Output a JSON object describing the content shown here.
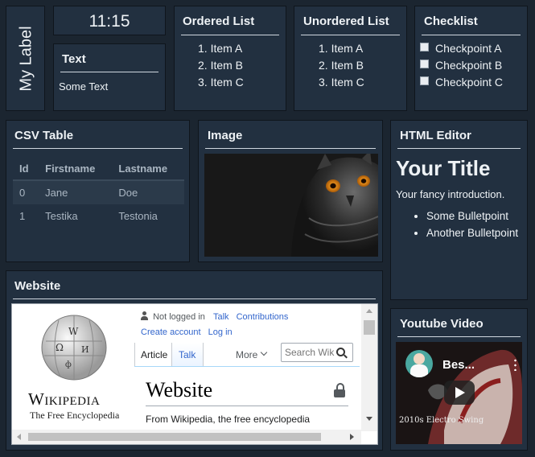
{
  "clock": {
    "time": "11:15"
  },
  "label_widget": {
    "text": "My Label"
  },
  "text_widget": {
    "title": "Text",
    "body": "Some Text"
  },
  "ordered_list": {
    "title": "Ordered List",
    "items": [
      "1. Item A",
      "2. Item B",
      "3. Item C"
    ]
  },
  "unordered_list": {
    "title": "Unordered List",
    "items": [
      "1. Item A",
      "2. Item B",
      "3. Item C"
    ]
  },
  "checklist": {
    "title": "Checklist",
    "items": [
      "Checkpoint A",
      "Checkpoint B",
      "Checkpoint C"
    ]
  },
  "csv_table": {
    "title": "CSV Table",
    "headers": [
      "Id",
      "Firstname",
      "Lastname"
    ],
    "rows": [
      [
        "0",
        "Jane",
        "Doe"
      ],
      [
        "1",
        "Testika",
        "Testonia"
      ]
    ]
  },
  "image_widget": {
    "title": "Image"
  },
  "html_editor": {
    "title": "HTML Editor",
    "heading": "Your Title",
    "intro": "Your fancy introduction.",
    "bullets": [
      "Some Bulletpoint",
      "Another Bulletpoint"
    ]
  },
  "website": {
    "title": "Website",
    "wordmark": "Wikipedia",
    "tagline": "The Free Encyclopedia",
    "not_logged_in": "Not logged in",
    "talk": "Talk",
    "contributions": "Contributions",
    "create_account": "Create account",
    "log_in": "Log in",
    "tab_article": "Article",
    "tab_talk": "Talk",
    "more": "More",
    "search_placeholder": "Search Wiki",
    "page_heading": "Website",
    "from_line": "From Wikipedia, the free encyclopedia"
  },
  "youtube": {
    "title": "Youtube Video",
    "video_title": "Bes...",
    "overlay_caption": "2010s Electro Swing"
  },
  "colors": {
    "page_bg": "#1b2530",
    "card_bg": "#223040",
    "link": "#3366cc"
  }
}
